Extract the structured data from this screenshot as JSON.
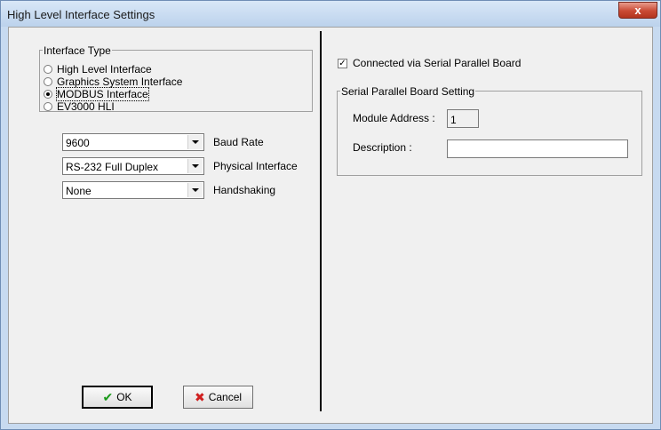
{
  "window": {
    "title": "High Level Interface Settings",
    "close_glyph": "x"
  },
  "interface_type": {
    "legend": "Interface Type",
    "options": [
      {
        "label": "High Level Interface",
        "checked": false
      },
      {
        "label": "Graphics System Interface",
        "checked": false
      },
      {
        "label": "MODBUS Interface",
        "checked": true
      },
      {
        "label": "EV3000 HLI",
        "checked": false
      }
    ]
  },
  "settings": [
    {
      "value": "9600",
      "label": "Baud Rate"
    },
    {
      "value": "RS-232 Full Duplex",
      "label": "Physical Interface"
    },
    {
      "value": "None",
      "label": "Handshaking"
    }
  ],
  "serial_parallel": {
    "connected_label": "Connected via Serial Parallel Board",
    "connected_checked": true,
    "legend": "Serial Parallel Board Setting",
    "module_address_label": "Module Address :",
    "module_address_value": "1",
    "description_label": "Description :",
    "description_value": ""
  },
  "buttons": {
    "ok_label": "OK",
    "ok_icon": "check-icon",
    "cancel_label": "Cancel",
    "cancel_icon": "x-icon"
  },
  "colors": {
    "check_green": "#1a9a1a",
    "cancel_red": "#d02020"
  }
}
